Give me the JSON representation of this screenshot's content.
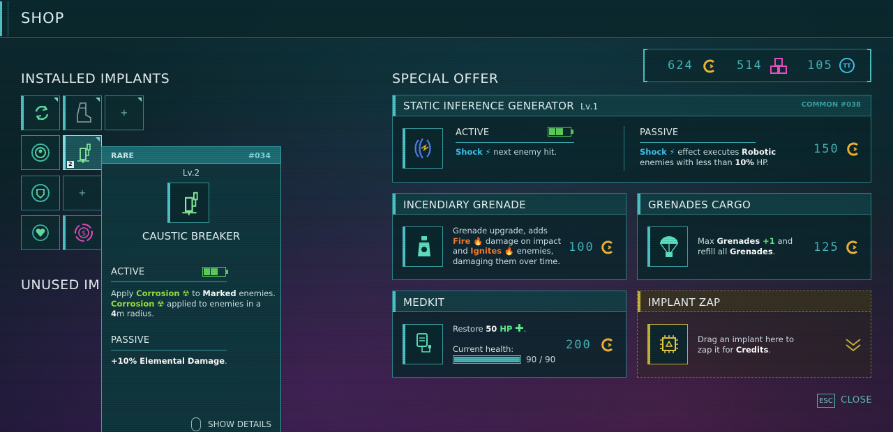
{
  "header": {
    "title": "SHOP"
  },
  "installed": {
    "title": "INSTALLED IMPLANTS",
    "slots": [
      {
        "icon": "cycle-arrows-icon"
      },
      {
        "icon": "boot-icon"
      },
      {
        "icon": "plus-icon",
        "label": "+"
      },
      {
        "icon": "head-shield-icon"
      },
      {
        "icon": "syringe-icon",
        "level": "2"
      },
      {
        "icon": "shield-emblem-icon"
      },
      {
        "icon": "plus-icon",
        "label": "+"
      },
      {
        "icon": "heart-plus-icon"
      },
      {
        "icon": "money-cycle-icon"
      }
    ]
  },
  "unused": {
    "title": "UNUSED IM"
  },
  "tooltip": {
    "rarity": "RARE",
    "id": "#034",
    "level": "Lv.2",
    "name": "CAUSTIC BREAKER",
    "active_title": "ACTIVE",
    "active_line1_a": "Apply ",
    "active_line1_b": "Corrosion",
    "active_line1_c": " to ",
    "active_line1_d": "Marked",
    "active_line1_e": " enemies.",
    "active_line2_a": "Corrosion",
    "active_line2_b": " applied to enemies in a",
    "active_line3_a": "4",
    "active_line3_b": "m radius.",
    "passive_title": "PASSIVE",
    "passive_text": "+10% Elemental Damage",
    "passive_suffix": ".",
    "show_details": "SHOW DETAILS"
  },
  "currency": {
    "credits": "624",
    "cubes": "514",
    "tokens": "105",
    "token_symbol": "TT"
  },
  "special_offer": {
    "title": "SPECIAL OFFER",
    "name": "STATIC INFERENCE GENERATOR",
    "level": "Lv.1",
    "rarity_id": "COMMON #038",
    "active_title": "ACTIVE",
    "active_a": "Shock",
    "active_b": " next enemy hit.",
    "passive_title": "PASSIVE",
    "passive_a": "Shock",
    "passive_b": " effect executes ",
    "passive_c": "Robotic",
    "passive_d": "enemies with less than ",
    "passive_e": "10%",
    "passive_f": " HP.",
    "price": "150"
  },
  "incendiary": {
    "title": "INCENDIARY GRENADE",
    "l1": "Grenade upgrade, adds",
    "l2a": "Fire",
    "l2b": " damage on impact",
    "l3a": "and ",
    "l3b": "Ignites",
    "l3c": " enemies,",
    "l4": "damaging them over time.",
    "price": "100"
  },
  "cargo": {
    "title": "GRENADES CARGO",
    "l1a": "Max ",
    "l1b": "Grenades",
    "l1c": " +1",
    "l1d": " and",
    "l2a": "refill all ",
    "l2b": "Grenades",
    "l2c": ".",
    "price": "125"
  },
  "medkit": {
    "title": "MEDKIT",
    "l1a": "Restore ",
    "l1b": "50",
    "l1c": " HP",
    "l1d": ".",
    "health_label": "Current health:",
    "health_value": "90 / 90",
    "health_fraction": 1.0,
    "price": "200"
  },
  "zap": {
    "title": "IMPLANT ZAP",
    "l1": "Drag an implant here to",
    "l2a": "zap it for ",
    "l2b": "Credits",
    "l2c": "."
  },
  "close": {
    "key": "ESC",
    "label": "CLOSE"
  },
  "colors": {
    "accent": "#4fc4c8",
    "coin": "#f2b632",
    "green": "#9be33a",
    "blue": "#3fc6f2",
    "orange": "#f47a2a",
    "pink": "#e84fc0"
  }
}
